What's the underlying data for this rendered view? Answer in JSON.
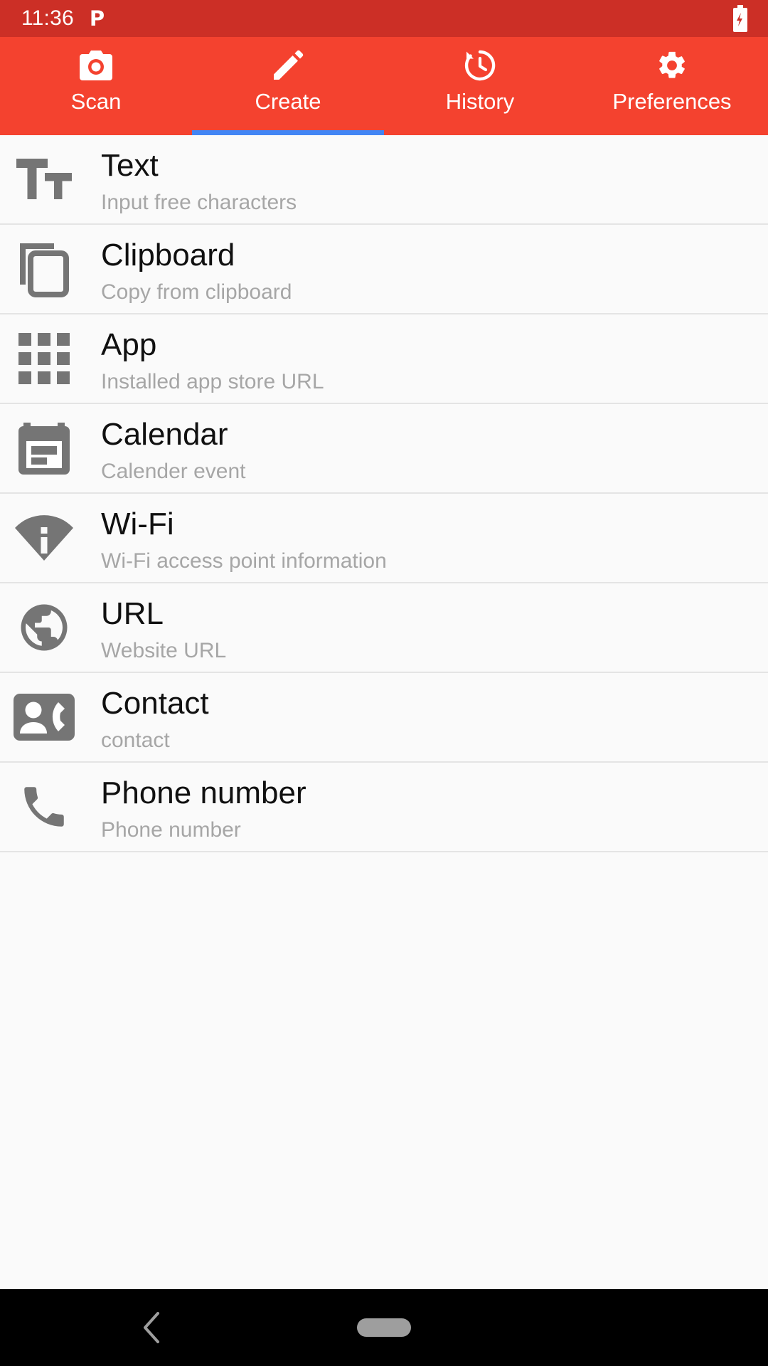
{
  "status_bar": {
    "time": "11:36",
    "notification_icon_label": "P",
    "battery_icon": "battery-charging-icon",
    "background_color": "#cc2f26"
  },
  "tabbar": {
    "background_color": "#f4422f",
    "active_indicator_color": "#4285f4",
    "active_tab_index": 1,
    "tabs": [
      {
        "label": "Scan",
        "icon": "camera-icon"
      },
      {
        "label": "Create",
        "icon": "pencil-icon"
      },
      {
        "label": "History",
        "icon": "history-clock-icon"
      },
      {
        "label": "Preferences",
        "icon": "gear-icon"
      }
    ]
  },
  "list": {
    "items": [
      {
        "title": "Text",
        "subtitle": "Input free characters",
        "icon": "text-format-icon"
      },
      {
        "title": "Clipboard",
        "subtitle": "Copy from clipboard",
        "icon": "clipboard-copy-icon"
      },
      {
        "title": "App",
        "subtitle": "Installed app store URL",
        "icon": "app-grid-icon"
      },
      {
        "title": "Calendar",
        "subtitle": "Calender event",
        "icon": "calendar-icon"
      },
      {
        "title": "Wi-Fi",
        "subtitle": "Wi-Fi access point information",
        "icon": "wifi-info-icon"
      },
      {
        "title": "URL",
        "subtitle": "Website URL",
        "icon": "globe-icon"
      },
      {
        "title": "Contact",
        "subtitle": "contact",
        "icon": "contact-card-icon"
      },
      {
        "title": "Phone number",
        "subtitle": "Phone number",
        "icon": "phone-icon"
      }
    ]
  },
  "navbar": {
    "background_color": "#000000",
    "back_icon": "chevron-left-icon",
    "home_icon": "home-pill-icon"
  }
}
